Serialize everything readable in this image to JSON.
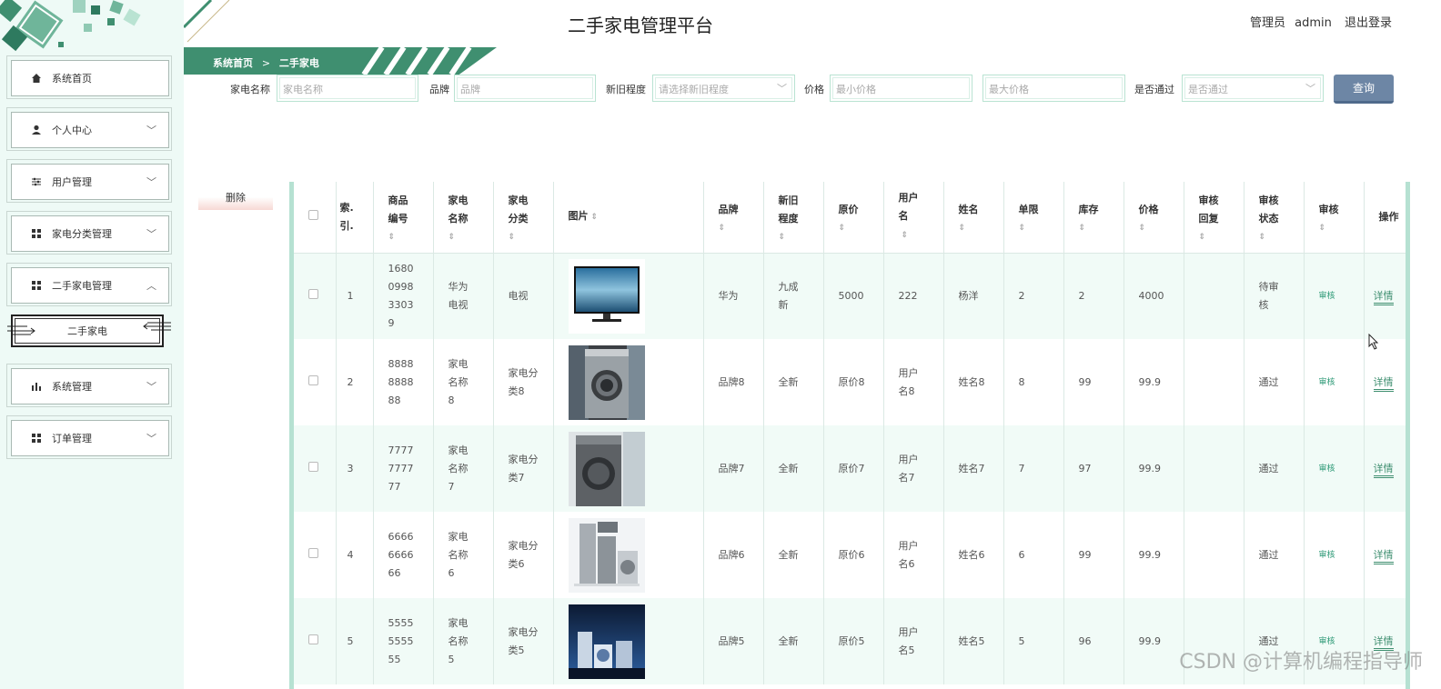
{
  "header": {
    "title": "二手家电管理平台",
    "role": "管理员",
    "username": "admin",
    "logout": "退出登录"
  },
  "breadcrumb": {
    "home": "系统首页",
    "separator": ">",
    "current": "二手家电"
  },
  "sidebar": {
    "items": [
      {
        "label": "系统首页"
      },
      {
        "label": "个人中心"
      },
      {
        "label": "用户管理"
      },
      {
        "label": "家电分类管理"
      },
      {
        "label": "二手家电管理"
      },
      {
        "label": "系统管理"
      },
      {
        "label": "订单管理"
      }
    ],
    "submenu_active": "二手家电"
  },
  "search": {
    "name_label": "家电名称",
    "name_placeholder": "家电名称",
    "brand_label": "品牌",
    "brand_placeholder": "品牌",
    "condition_label": "新旧程度",
    "condition_placeholder": "请选择新旧程度",
    "price_label": "价格",
    "price_min_placeholder": "最小价格",
    "price_max_placeholder": "最大价格",
    "approved_label": "是否通过",
    "approved_placeholder": "是否通过",
    "query_button": "查询"
  },
  "actions": {
    "delete_button": "删除"
  },
  "table": {
    "headers": {
      "index": "索.引.",
      "code": "商品编号",
      "name": "家电名称",
      "category": "家电分类",
      "image": "图片",
      "brand": "品牌",
      "condition": "新旧程度",
      "original_price": "原价",
      "username": "用户名",
      "realname": "姓名",
      "limit": "单限",
      "stock": "库存",
      "price": "价格",
      "reply": "审核回复",
      "status": "审核状态",
      "audit": "审核",
      "operation": "操作"
    },
    "rows": [
      {
        "index": "1",
        "code": "1680099833039",
        "name": "华为电视",
        "category": "电视",
        "brand": "华为",
        "condition": "九成新",
        "original_price": "5000",
        "username": "222",
        "realname": "杨洋",
        "limit": "2",
        "stock": "2",
        "price": "4000",
        "reply": "",
        "status": "待审核",
        "audit": "审核",
        "detail": "详情"
      },
      {
        "index": "2",
        "code": "8888888888",
        "name": "家电名称8",
        "category": "家电分类8",
        "brand": "品牌8",
        "condition": "全新",
        "original_price": "原价8",
        "username": "用户名8",
        "realname": "姓名8",
        "limit": "8",
        "stock": "99",
        "price": "99.9",
        "reply": "",
        "status": "通过",
        "audit": "审核",
        "detail": "详情"
      },
      {
        "index": "3",
        "code": "7777777777",
        "name": "家电名称7",
        "category": "家电分类7",
        "brand": "品牌7",
        "condition": "全新",
        "original_price": "原价7",
        "username": "用户名7",
        "realname": "姓名7",
        "limit": "7",
        "stock": "97",
        "price": "99.9",
        "reply": "",
        "status": "通过",
        "audit": "审核",
        "detail": "详情"
      },
      {
        "index": "4",
        "code": "6666666666",
        "name": "家电名称6",
        "category": "家电分类6",
        "brand": "品牌6",
        "condition": "全新",
        "original_price": "原价6",
        "username": "用户名6",
        "realname": "姓名6",
        "limit": "6",
        "stock": "99",
        "price": "99.9",
        "reply": "",
        "status": "通过",
        "audit": "审核",
        "detail": "详情"
      },
      {
        "index": "5",
        "code": "5555555555",
        "name": "家电名称5",
        "category": "家电分类5",
        "brand": "品牌5",
        "condition": "全新",
        "original_price": "原价5",
        "username": "用户名5",
        "realname": "姓名5",
        "limit": "5",
        "stock": "96",
        "price": "99.9",
        "reply": "",
        "status": "通过",
        "audit": "审核",
        "detail": "详情"
      }
    ]
  },
  "watermark": "CSDN @计算机编程指导师"
}
